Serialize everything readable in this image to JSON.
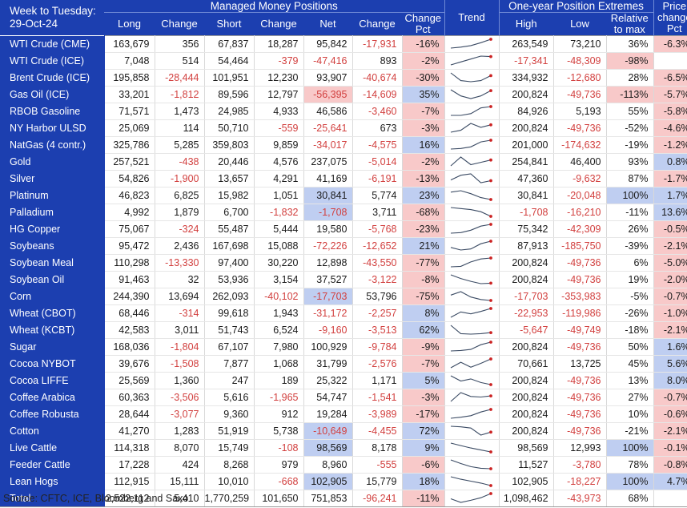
{
  "header": {
    "title_line1": "Week to Tuesday:",
    "title_line2": "29-Oct-24",
    "group_managed": "Managed Money Positions",
    "group_extremes": "One-year Position Extremes",
    "col_long": "Long",
    "col_change1": "Change",
    "col_short": "Short",
    "col_change2": "Change",
    "col_net": "Net",
    "col_change3": "Change",
    "col_change_pct": "Change Pct",
    "col_trend": "Trend",
    "col_high": "High",
    "col_low": "Low",
    "col_relmax": "Relative to max",
    "col_price_pct": "Price change Pct"
  },
  "source": "Source: CFTC, ICE, Bloomberg and Saxo",
  "colors": {
    "header_blue": "#1c3fb0",
    "highlight_pink": "#f8c9c9",
    "highlight_blue": "#bfcef1",
    "negative_text": "#d2403f",
    "sparkline_line": "#3a4a63",
    "sparkline_dot": "#cc2222"
  },
  "chart_data": {
    "type": "table",
    "title": "Managed Money Positions — Week to Tuesday: 29-Oct-24",
    "columns": [
      "Commodity",
      "Long",
      "Change",
      "Short",
      "Change",
      "Net",
      "Change",
      "Change Pct",
      "Trend",
      "High",
      "Low",
      "Relative to max",
      "Price change Pct"
    ],
    "rows": [
      {
        "label": "WTI Crude (CME)",
        "group": "energy",
        "group_top": true,
        "long": "163,679",
        "change1": "356",
        "short": "67,837",
        "change2": "18,287",
        "net": "95,842",
        "change3": "-17,931",
        "chgpct": "-16%",
        "high": "263,549",
        "low": "73,210",
        "relmax": "36%",
        "pricepct": "-6.3%",
        "fmt": {
          "change1": "",
          "change2": "",
          "net": "",
          "change3": "neg",
          "chgpct": "pink",
          "high": "",
          "low": "",
          "relmax": "",
          "pricepct": "pink"
        },
        "spark": [
          30,
          34,
          40,
          52,
          66
        ]
      },
      {
        "label": "WTI Crude (ICE)",
        "group": "energy",
        "long": "7,048",
        "change1": "514",
        "short": "54,464",
        "change2": "-379",
        "net": "-47,416",
        "change3": "893",
        "chgpct": "-2%",
        "high": "-17,341",
        "low": "-48,309",
        "relmax": "-98%",
        "pricepct": "",
        "fmt": {
          "change2": "neg",
          "net": "neg",
          "chgpct": "pink",
          "high": "neg",
          "low": "neg",
          "relmax": "pink",
          "pricepct": ""
        },
        "spark": [
          28,
          40,
          52,
          64,
          62
        ]
      },
      {
        "label": "Brent Crude (ICE)",
        "group": "energy",
        "long": "195,858",
        "change1": "-28,444",
        "short": "101,951",
        "change2": "12,230",
        "net": "93,907",
        "change3": "-40,674",
        "chgpct": "-30%",
        "high": "334,932",
        "low": "-12,680",
        "relmax": "28%",
        "pricepct": "-6.5%",
        "fmt": {
          "change1": "neg",
          "change3": "neg",
          "chgpct": "pink",
          "low": "neg",
          "pricepct": "pink"
        },
        "spark": [
          62,
          34,
          30,
          34,
          52
        ]
      },
      {
        "label": "Gas Oil (ICE)",
        "group": "energy",
        "long": "33,201",
        "change1": "-1,812",
        "short": "89,596",
        "change2": "12,797",
        "net": "-56,395",
        "change3": "-14,609",
        "chgpct": "35%",
        "high": "200,824",
        "low": "-49,736",
        "relmax": "-113%",
        "pricepct": "-5.7%",
        "fmt": {
          "change1": "neg",
          "net": "neg pink",
          "change3": "neg",
          "chgpct": "blue",
          "low": "neg",
          "relmax": "pink",
          "pricepct": "pink"
        },
        "spark": [
          62,
          34,
          22,
          34,
          58
        ]
      },
      {
        "label": "RBOB Gasoline",
        "group": "energy",
        "long": "71,571",
        "change1": "1,473",
        "short": "24,985",
        "change2": "4,933",
        "net": "46,586",
        "change3": "-3,460",
        "chgpct": "-7%",
        "high": "84,926",
        "low": "5,193",
        "relmax": "55%",
        "pricepct": "-5.8%",
        "fmt": {
          "change3": "neg",
          "chgpct": "pink",
          "pricepct": "pink"
        },
        "spark": [
          22,
          22,
          30,
          56,
          62
        ]
      },
      {
        "label": "NY Harbor ULSD",
        "group": "energy",
        "long": "25,069",
        "change1": "114",
        "short": "50,710",
        "change2": "-559",
        "net": "-25,641",
        "change3": "673",
        "chgpct": "-3%",
        "high": "200,824",
        "low": "-49,736",
        "relmax": "-52%",
        "pricepct": "-4.6%",
        "fmt": {
          "change2": "neg",
          "net": "neg",
          "chgpct": "pink",
          "low": "neg",
          "pricepct": "pink"
        },
        "spark": [
          22,
          30,
          58,
          42,
          52
        ]
      },
      {
        "label": "NatGas (4 contr.)",
        "group": "energy",
        "long": "325,786",
        "change1": "5,285",
        "short": "359,803",
        "change2": "9,859",
        "net": "-34,017",
        "change3": "-4,575",
        "chgpct": "16%",
        "high": "201,000",
        "low": "-174,632",
        "relmax": "-19%",
        "pricepct": "-1.2%",
        "fmt": {
          "net": "neg",
          "change3": "neg",
          "chgpct": "blue",
          "low": "neg",
          "pricepct": "pink"
        },
        "spark": [
          26,
          28,
          34,
          52,
          58
        ]
      },
      {
        "label": "Gold",
        "group": "metals",
        "group_top": true,
        "long": "257,521",
        "change1": "-438",
        "short": "20,446",
        "change2": "4,576",
        "net": "237,075",
        "change3": "-5,014",
        "chgpct": "-2%",
        "high": "254,841",
        "low": "46,400",
        "relmax": "93%",
        "pricepct": "0.8%",
        "fmt": {
          "change1": "neg",
          "change3": "neg",
          "chgpct": "pink",
          "pricepct": "blue"
        },
        "spark": [
          26,
          56,
          30,
          38,
          46
        ]
      },
      {
        "label": "Silver",
        "group": "metals",
        "long": "54,826",
        "change1": "-1,900",
        "short": "13,657",
        "change2": "4,291",
        "net": "41,169",
        "change3": "-6,191",
        "chgpct": "-13%",
        "high": "47,360",
        "low": "-9,632",
        "relmax": "87%",
        "pricepct": "-1.7%",
        "fmt": {
          "change1": "neg",
          "change3": "neg",
          "chgpct": "pink",
          "low": "neg",
          "pricepct": "pink"
        },
        "spark": [
          38,
          52,
          56,
          30,
          36
        ]
      },
      {
        "label": "Platinum",
        "group": "metals",
        "long": "46,823",
        "change1": "6,825",
        "short": "15,982",
        "change2": "1,051",
        "net": "30,841",
        "change3": "5,774",
        "chgpct": "23%",
        "high": "30,841",
        "low": "-20,048",
        "relmax": "100%",
        "pricepct": "1.7%",
        "fmt": {
          "net": "blue",
          "chgpct": "blue",
          "low": "neg",
          "relmax": "blue",
          "pricepct": "blue"
        },
        "spark": [
          54,
          60,
          48,
          32,
          24
        ]
      },
      {
        "label": "Palladium",
        "group": "metals",
        "long": "4,992",
        "change1": "1,879",
        "short": "6,700",
        "change2": "-1,832",
        "net": "-1,708",
        "change3": "3,711",
        "chgpct": "-68%",
        "high": "-1,708",
        "low": "-16,210",
        "relmax": "-11%",
        "pricepct": "13.6%",
        "fmt": {
          "change2": "neg",
          "net": "neg blue",
          "chgpct": "pink",
          "high": "neg",
          "low": "neg",
          "pricepct": "blue"
        },
        "spark": [
          56,
          52,
          48,
          40,
          22
        ]
      },
      {
        "label": "HG Copper",
        "group": "metals",
        "long": "75,067",
        "change1": "-324",
        "short": "55,487",
        "change2": "5,444",
        "net": "19,580",
        "change3": "-5,768",
        "chgpct": "-23%",
        "high": "75,342",
        "low": "-42,309",
        "relmax": "26%",
        "pricepct": "-0.5%",
        "fmt": {
          "change1": "neg",
          "change3": "neg",
          "chgpct": "pink",
          "low": "neg",
          "pricepct": "pink"
        },
        "spark": [
          26,
          28,
          36,
          50,
          56
        ]
      },
      {
        "label": "Soybeans",
        "group": "grains",
        "group_top": true,
        "long": "95,472",
        "change1": "2,436",
        "short": "167,698",
        "change2": "15,088",
        "net": "-72,226",
        "change3": "-12,652",
        "chgpct": "21%",
        "high": "87,913",
        "low": "-185,750",
        "relmax": "-39%",
        "pricepct": "-2.1%",
        "fmt": {
          "net": "neg",
          "change3": "neg",
          "chgpct": "blue",
          "low": "neg",
          "pricepct": "pink"
        },
        "spark": [
          34,
          24,
          28,
          48,
          58
        ]
      },
      {
        "label": "Soybean Meal",
        "group": "grains",
        "long": "110,298",
        "change1": "-13,330",
        "short": "97,400",
        "change2": "30,220",
        "net": "12,898",
        "change3": "-43,550",
        "chgpct": "-77%",
        "high": "200,824",
        "low": "-49,736",
        "relmax": "6%",
        "pricepct": "-5.0%",
        "fmt": {
          "change1": "neg",
          "change3": "neg",
          "chgpct": "pink",
          "low": "neg",
          "pricepct": "pink"
        },
        "spark": [
          24,
          26,
          44,
          56,
          60
        ]
      },
      {
        "label": "Soybean Oil",
        "group": "grains",
        "long": "91,463",
        "change1": "32",
        "short": "53,936",
        "change2": "3,154",
        "net": "37,527",
        "change3": "-3,122",
        "chgpct": "-8%",
        "high": "200,824",
        "low": "-49,736",
        "relmax": "19%",
        "pricepct": "-2.0%",
        "fmt": {
          "change3": "neg",
          "chgpct": "pink",
          "low": "neg",
          "pricepct": "pink"
        },
        "spark": [
          62,
          46,
          34,
          24,
          26
        ]
      },
      {
        "label": "Corn",
        "group": "grains",
        "long": "244,390",
        "change1": "13,694",
        "short": "262,093",
        "change2": "-40,102",
        "net": "-17,703",
        "change3": "53,796",
        "chgpct": "-75%",
        "high": "-17,703",
        "low": "-353,983",
        "relmax": "-5%",
        "pricepct": "-0.7%",
        "fmt": {
          "change2": "neg",
          "net": "neg blue",
          "chgpct": "pink",
          "high": "neg",
          "low": "neg",
          "pricepct": "pink"
        },
        "spark": [
          44,
          58,
          36,
          26,
          22
        ]
      },
      {
        "label": "Wheat (CBOT)",
        "group": "grains",
        "long": "68,446",
        "change1": "-314",
        "short": "99,618",
        "change2": "1,943",
        "net": "-31,172",
        "change3": "-2,257",
        "chgpct": "8%",
        "high": "-22,953",
        "low": "-119,986",
        "relmax": "-26%",
        "pricepct": "-1.0%",
        "fmt": {
          "change1": "neg",
          "net": "neg",
          "change3": "neg",
          "chgpct": "blue",
          "high": "neg",
          "low": "neg",
          "pricepct": "pink"
        },
        "spark": [
          24,
          46,
          38,
          48,
          60
        ]
      },
      {
        "label": "Wheat (KCBT)",
        "group": "grains",
        "long": "42,583",
        "change1": "3,011",
        "short": "51,743",
        "change2": "6,524",
        "net": "-9,160",
        "change3": "-3,513",
        "chgpct": "62%",
        "high": "-5,647",
        "low": "-49,749",
        "relmax": "-18%",
        "pricepct": "-2.1%",
        "fmt": {
          "net": "neg",
          "change3": "neg",
          "chgpct": "blue",
          "high": "neg",
          "low": "neg",
          "pricepct": "pink"
        },
        "spark": [
          62,
          30,
          28,
          30,
          34
        ]
      },
      {
        "label": "Sugar",
        "group": "softs",
        "group_top": true,
        "long": "168,036",
        "change1": "-1,804",
        "short": "67,107",
        "change2": "7,980",
        "net": "100,929",
        "change3": "-9,784",
        "chgpct": "-9%",
        "high": "200,824",
        "low": "-49,736",
        "relmax": "50%",
        "pricepct": "1.6%",
        "fmt": {
          "change1": "neg",
          "change3": "neg",
          "chgpct": "pink",
          "low": "neg",
          "pricepct": "blue"
        },
        "spark": [
          24,
          26,
          30,
          48,
          58
        ]
      },
      {
        "label": "Cocoa NYBOT",
        "group": "softs",
        "long": "39,676",
        "change1": "-1,508",
        "short": "7,877",
        "change2": "1,068",
        "net": "31,799",
        "change3": "-2,576",
        "chgpct": "-7%",
        "high": "70,661",
        "low": "13,725",
        "relmax": "45%",
        "pricepct": "5.6%",
        "fmt": {
          "change1": "neg",
          "change3": "neg",
          "chgpct": "pink",
          "pricepct": "blue"
        },
        "spark": [
          26,
          46,
          28,
          42,
          58
        ]
      },
      {
        "label": "Cocoa LIFFE",
        "group": "softs",
        "long": "25,569",
        "change1": "1,360",
        "short": "247",
        "change2": "189",
        "net": "25,322",
        "change3": "1,171",
        "chgpct": "5%",
        "high": "200,824",
        "low": "-49,736",
        "relmax": "13%",
        "pricepct": "8.0%",
        "fmt": {
          "chgpct": "blue",
          "low": "neg",
          "pricepct": "blue"
        },
        "spark": [
          56,
          36,
          44,
          30,
          22
        ]
      },
      {
        "label": "Coffee Arabica",
        "group": "softs",
        "long": "60,363",
        "change1": "-3,506",
        "short": "5,616",
        "change2": "-1,965",
        "net": "54,747",
        "change3": "-1,541",
        "chgpct": "-3%",
        "high": "200,824",
        "low": "-49,736",
        "relmax": "27%",
        "pricepct": "-0.7%",
        "fmt": {
          "change1": "neg",
          "change2": "neg",
          "change3": "neg",
          "chgpct": "pink",
          "low": "neg",
          "pricepct": "pink"
        },
        "spark": [
          22,
          54,
          40,
          38,
          42
        ]
      },
      {
        "label": "Coffee Robusta",
        "group": "softs",
        "long": "28,644",
        "change1": "-3,077",
        "short": "9,360",
        "change2": "912",
        "net": "19,284",
        "change3": "-3,989",
        "chgpct": "-17%",
        "high": "200,824",
        "low": "-49,736",
        "relmax": "10%",
        "pricepct": "-0.6%",
        "fmt": {
          "change1": "neg",
          "change3": "neg",
          "chgpct": "pink",
          "low": "neg",
          "pricepct": "pink"
        },
        "spark": [
          24,
          28,
          34,
          48,
          58
        ]
      },
      {
        "label": "Cotton",
        "group": "softs",
        "long": "41,270",
        "change1": "1,283",
        "short": "51,919",
        "change2": "5,738",
        "net": "-10,649",
        "change3": "-4,455",
        "chgpct": "72%",
        "high": "200,824",
        "low": "-49,736",
        "relmax": "-21%",
        "pricepct": "-2.1%",
        "fmt": {
          "net": "neg blue",
          "change3": "neg",
          "chgpct": "blue",
          "low": "neg",
          "pricepct": "pink"
        },
        "spark": [
          54,
          52,
          48,
          24,
          34
        ]
      },
      {
        "label": "Live Cattle",
        "group": "meats",
        "group_top": true,
        "long": "114,318",
        "change1": "8,070",
        "short": "15,749",
        "change2": "-108",
        "net": "98,569",
        "change3": "8,178",
        "chgpct": "9%",
        "high": "98,569",
        "low": "12,993",
        "relmax": "100%",
        "pricepct": "-0.1%",
        "fmt": {
          "change2": "neg",
          "net": "blue",
          "chgpct": "blue",
          "relmax": "blue",
          "pricepct": "pink"
        },
        "spark": [
          58,
          48,
          38,
          30,
          22
        ]
      },
      {
        "label": "Feeder Cattle",
        "group": "meats",
        "long": "17,228",
        "change1": "424",
        "short": "8,268",
        "change2": "979",
        "net": "8,960",
        "change3": "-555",
        "chgpct": "-6%",
        "high": "11,527",
        "low": "-3,780",
        "relmax": "78%",
        "pricepct": "-0.8%",
        "fmt": {
          "change3": "neg",
          "chgpct": "pink",
          "low": "neg",
          "pricepct": "pink"
        },
        "spark": [
          56,
          42,
          30,
          24,
          22
        ]
      },
      {
        "label": "Lean Hogs",
        "group": "meats",
        "long": "112,915",
        "change1": "15,111",
        "short": "10,010",
        "change2": "-668",
        "net": "102,905",
        "change3": "15,779",
        "chgpct": "18%",
        "high": "102,905",
        "low": "-18,227",
        "relmax": "100%",
        "pricepct": "4.7%",
        "fmt": {
          "change2": "neg",
          "net": "blue",
          "chgpct": "blue",
          "low": "neg",
          "relmax": "blue",
          "pricepct": "blue"
        },
        "spark": [
          58,
          48,
          40,
          32,
          22
        ]
      },
      {
        "label": "Total",
        "group": "total",
        "total": true,
        "long": "2,522,112",
        "change1": "5,410",
        "short": "1,770,259",
        "change2": "101,650",
        "net": "751,853",
        "change3": "-96,241",
        "chgpct": "-11%",
        "high": "1,098,462",
        "low": "-43,973",
        "relmax": "68%",
        "pricepct": "",
        "fmt": {
          "change3": "neg",
          "chgpct": "pink",
          "low": "neg"
        },
        "spark": [
          40,
          26,
          34,
          44,
          60
        ]
      }
    ]
  }
}
